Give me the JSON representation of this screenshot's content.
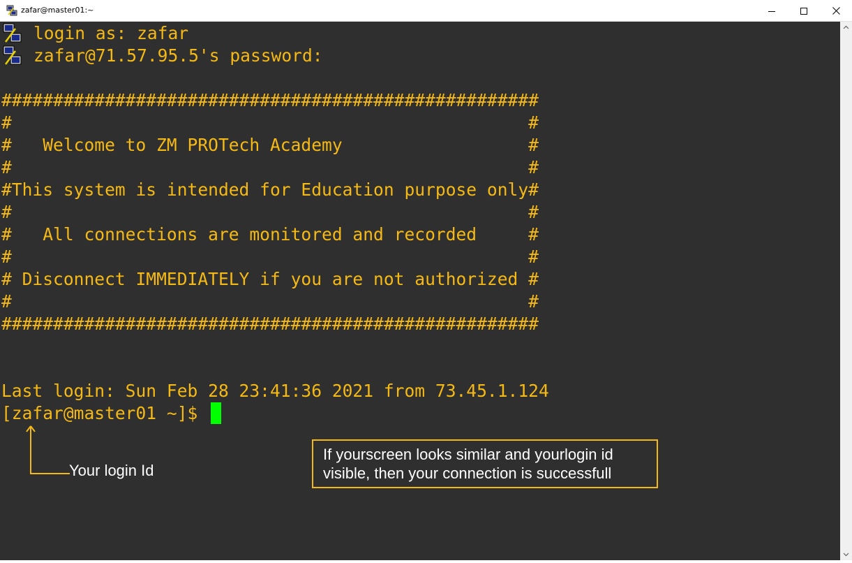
{
  "window": {
    "title": "zafar@master01:~"
  },
  "terminal": {
    "prompt_lines": [
      "login as: zafar",
      "zafar@71.57.95.5's password:"
    ],
    "banner_lines": [
      "####################################################",
      "#                                                  #",
      "#   Welcome to ZM PROTech Academy                  #",
      "#                                                  #",
      "#This system is intended for Education purpose only#",
      "#                                                  #",
      "#   All connections are monitored and recorded     #",
      "#                                                  #",
      "# Disconnect IMMEDIATELY if you are not authorized #",
      "#                                                  #",
      "####################################################"
    ],
    "last_login": "Last login: Sun Feb 28 23:41:36 2021 from 73.45.1.124",
    "shell_prompt": "[zafar@master01 ~]$ "
  },
  "annotations": {
    "login_id_label": "Your login Id",
    "callout_lines": [
      "If yourscreen looks similar and yourlogin id",
      "visible, then your connection is successfull"
    ]
  },
  "colors": {
    "terminal_bg": "#2f2f2f",
    "terminal_text": "#f5b915",
    "cursor": "#00ff00",
    "annotation_border": "#f5b915",
    "annotation_text": "#ffffff"
  }
}
